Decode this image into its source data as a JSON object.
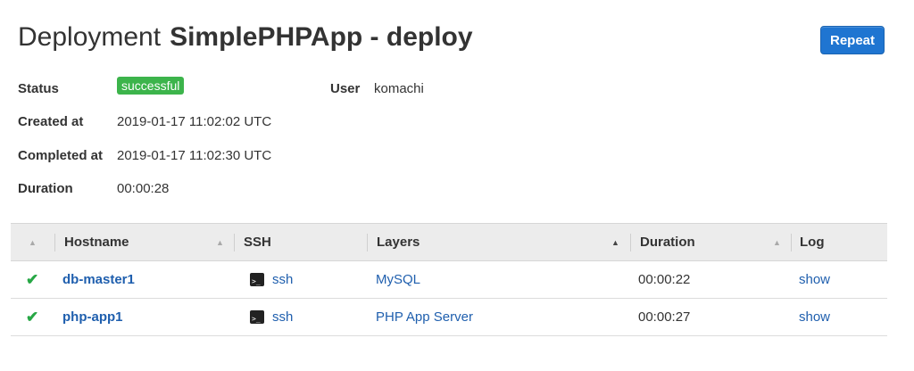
{
  "header": {
    "title_prefix": "Deployment",
    "title_name": "SimplePHPApp - deploy",
    "repeat_label": "Repeat"
  },
  "details": {
    "status_label": "Status",
    "status_value": "successful",
    "user_label": "User",
    "user_value": "komachi",
    "created_label": "Created at",
    "created_value": "2019-01-17 11:02:02 UTC",
    "completed_label": "Completed at",
    "completed_value": "2019-01-17 11:02:30 UTC",
    "duration_label": "Duration",
    "duration_value": "00:00:28"
  },
  "table": {
    "columns": [
      "Hostname",
      "SSH",
      "Layers",
      "Duration",
      "Log"
    ],
    "rows": [
      {
        "hostname": "db-master1",
        "ssh": "ssh",
        "layers": "MySQL",
        "duration": "00:00:22",
        "log": "show"
      },
      {
        "hostname": "php-app1",
        "ssh": "ssh",
        "layers": "PHP App Server",
        "duration": "00:00:27",
        "log": "show"
      }
    ]
  },
  "icons": {
    "sort": "sort-triangle-icon",
    "check": "check-icon",
    "terminal": "terminal-icon"
  },
  "colors": {
    "accent": "#1f75d1",
    "link": "#1f5fae",
    "success": "#3cb44b",
    "check": "#27a745"
  }
}
